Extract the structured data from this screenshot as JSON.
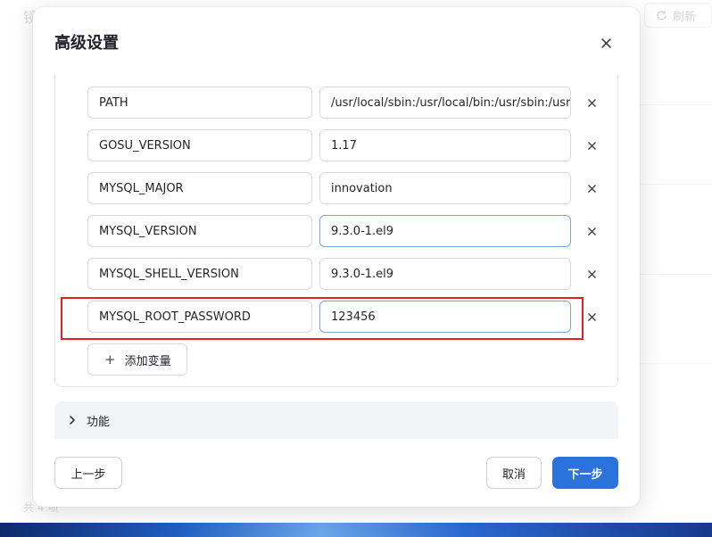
{
  "background": {
    "title": "镜",
    "refresh_label": "刷新",
    "footer_text": "共 4 项"
  },
  "dialog": {
    "title": "高级设置",
    "env_vars": [
      {
        "key": "PATH",
        "value": "/usr/local/sbin:/usr/local/bin:/usr/sbin:/usr/bin:/sbin:/bin"
      },
      {
        "key": "GOSU_VERSION",
        "value": "1.17"
      },
      {
        "key": "MYSQL_MAJOR",
        "value": "innovation"
      },
      {
        "key": "MYSQL_VERSION",
        "value": "9.3.0-1.el9"
      },
      {
        "key": "MYSQL_SHELL_VERSION",
        "value": "9.3.0-1.el9"
      },
      {
        "key": "MYSQL_ROOT_PASSWORD",
        "value": "123456"
      }
    ],
    "add_variable_label": "添加变量",
    "section_features_label": "功能",
    "prev_label": "上一步",
    "cancel_label": "取消",
    "next_label": "下一步"
  },
  "colors": {
    "primary": "#2a73dd",
    "highlight_box": "#e02020"
  }
}
